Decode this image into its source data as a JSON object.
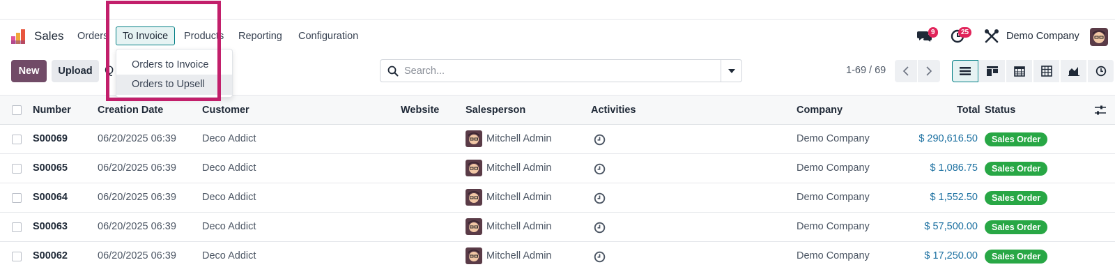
{
  "app": {
    "name": "Sales",
    "menu": [
      "Orders",
      "To Invoice",
      "Products",
      "Reporting",
      "Configuration"
    ],
    "active_menu": "To Invoice",
    "messages_count": "9",
    "activities_count": "25",
    "company": "Demo Company"
  },
  "dropdown": {
    "items": [
      "Orders to Invoice",
      "Orders to Upsell"
    ],
    "hovered": "Orders to Upsell"
  },
  "control_panel": {
    "new_label": "New",
    "upload_label": "Upload",
    "breadcrumb": "Quotations",
    "search_placeholder": "Search...",
    "pager": "1-69 / 69"
  },
  "table": {
    "columns": [
      "Number",
      "Creation Date",
      "Customer",
      "Website",
      "Salesperson",
      "Activities",
      "Company",
      "Total",
      "Status"
    ],
    "rows": [
      {
        "number": "S00069",
        "date": "06/20/2025 06:39",
        "customer": "Deco Addict",
        "salesperson": "Mitchell Admin",
        "company": "Demo Company",
        "total": "$ 290,616.50",
        "status": "Sales Order"
      },
      {
        "number": "S00065",
        "date": "06/20/2025 06:39",
        "customer": "Deco Addict",
        "salesperson": "Mitchell Admin",
        "company": "Demo Company",
        "total": "$ 1,086.75",
        "status": "Sales Order"
      },
      {
        "number": "S00064",
        "date": "06/20/2025 06:39",
        "customer": "Deco Addict",
        "salesperson": "Mitchell Admin",
        "company": "Demo Company",
        "total": "$ 1,552.50",
        "status": "Sales Order"
      },
      {
        "number": "S00063",
        "date": "06/20/2025 06:39",
        "customer": "Deco Addict",
        "salesperson": "Mitchell Admin",
        "company": "Demo Company",
        "total": "$ 57,500.00",
        "status": "Sales Order"
      },
      {
        "number": "S00062",
        "date": "06/20/2025 06:39",
        "customer": "Deco Addict",
        "salesperson": "Mitchell Admin",
        "company": "Demo Company",
        "total": "$ 17,250.00",
        "status": "Sales Order"
      }
    ]
  },
  "colors": {
    "brand": "#714b67",
    "accent": "#017e84",
    "status_green": "#28a745",
    "badge_red": "#e1245a",
    "highlight": "#c21f6b",
    "total_blue": "#1a6fa0"
  }
}
